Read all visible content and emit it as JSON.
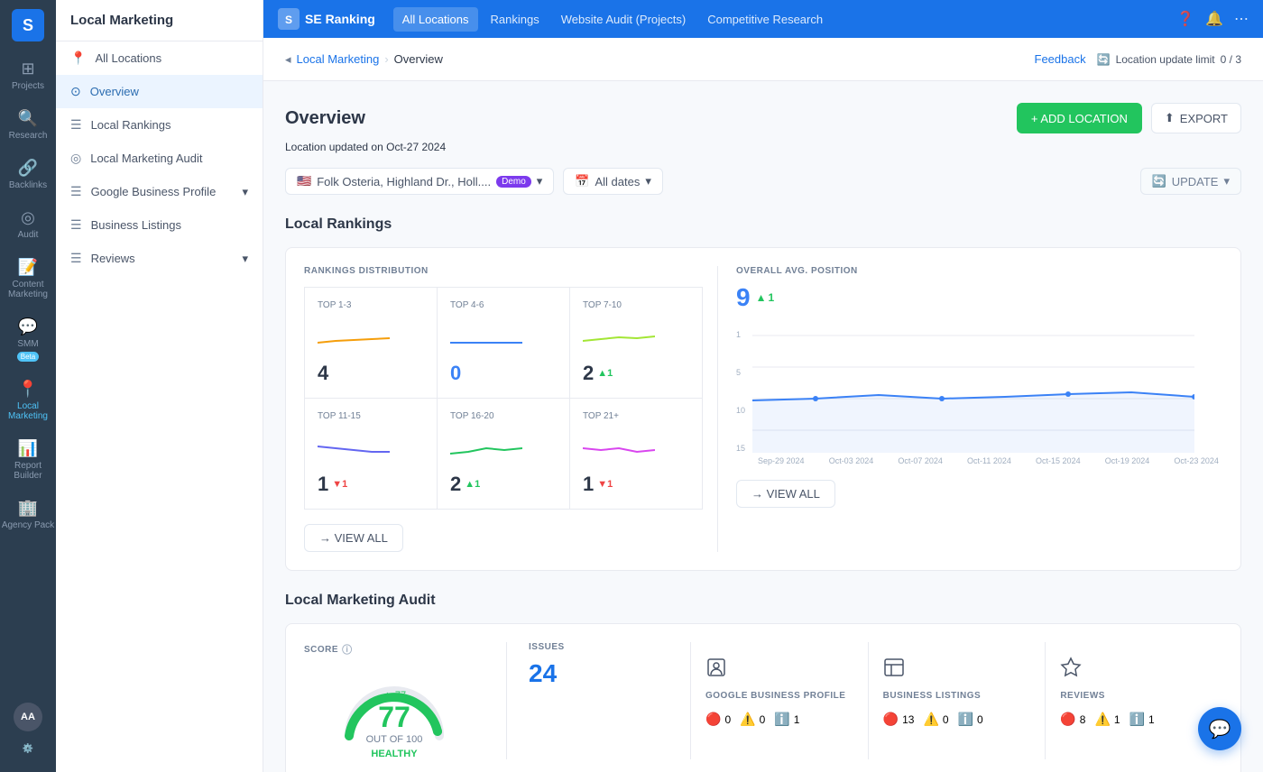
{
  "app": {
    "logo_text": "SE Ranking",
    "logo_icon": "📊"
  },
  "top_nav": {
    "items": [
      {
        "id": "all-locations",
        "label": "All Locations",
        "active": true
      },
      {
        "id": "rankings",
        "label": "Rankings",
        "active": false
      },
      {
        "id": "website-audit",
        "label": "Website Audit (Projects)",
        "active": false
      },
      {
        "id": "competitive-research",
        "label": "Competitive Research",
        "active": false
      }
    ]
  },
  "sidebar": {
    "header": "Local Marketing",
    "items": [
      {
        "id": "all-locations",
        "label": "All Locations",
        "icon": "📍",
        "active": false
      },
      {
        "id": "overview",
        "label": "Overview",
        "icon": "⊙",
        "active": true
      },
      {
        "id": "local-rankings",
        "label": "Local Rankings",
        "icon": "☰",
        "active": false
      },
      {
        "id": "local-marketing-audit",
        "label": "Local Marketing Audit",
        "icon": "◎",
        "active": false
      },
      {
        "id": "google-business-profile",
        "label": "Google Business Profile",
        "icon": "☰",
        "active": false,
        "has_submenu": true
      },
      {
        "id": "business-listings",
        "label": "Business Listings",
        "icon": "☰",
        "active": false
      },
      {
        "id": "reviews",
        "label": "Reviews",
        "icon": "☰",
        "active": false,
        "has_submenu": true
      }
    ]
  },
  "left_nav": {
    "items": [
      {
        "id": "projects",
        "label": "Projects",
        "icon": "⊞"
      },
      {
        "id": "research",
        "label": "Research",
        "icon": "🔍"
      },
      {
        "id": "backlinks",
        "label": "Backlinks",
        "icon": "🔗"
      },
      {
        "id": "audit",
        "label": "Audit",
        "icon": "◎"
      },
      {
        "id": "content-marketing",
        "label": "Content Marketing",
        "icon": "📝"
      },
      {
        "id": "smm",
        "label": "SMM",
        "icon": "💬",
        "badge": "Beta"
      },
      {
        "id": "local-marketing",
        "label": "Local Marketing",
        "icon": "📍",
        "active": true
      },
      {
        "id": "report-builder",
        "label": "Report Builder",
        "icon": "📊"
      },
      {
        "id": "agency-pack",
        "label": "Agency Pack",
        "icon": "🏢"
      }
    ],
    "avatar_initials": "AA"
  },
  "breadcrumb": {
    "parent": "Local Marketing",
    "current": "Overview"
  },
  "top_right": {
    "feedback_label": "Feedback",
    "location_update_icon": "🔄",
    "location_update_text": "Location update limit",
    "location_update_value": "0 / 3"
  },
  "page": {
    "title": "Overview",
    "location_updated_label": "Location updated on",
    "location_updated_date": "Oct-27 2024",
    "add_location_label": "+ ADD LOCATION",
    "export_label": "EXPORT"
  },
  "filters": {
    "location_name": "Folk Osteria, Highland Dr., Holl....",
    "demo_badge": "Demo",
    "dates_label": "All dates",
    "update_label": "UPDATE"
  },
  "local_rankings": {
    "section_title": "Local Rankings",
    "dist_label": "RANKINGS DISTRIBUTION",
    "avg_label": "OVERALL AVG. POSITION",
    "avg_value": "9",
    "avg_change": "▲1",
    "avg_change_sign": "+",
    "cells": [
      {
        "label": "TOP 1-3",
        "value": "4",
        "change": "",
        "color": "orange"
      },
      {
        "label": "TOP 4-6",
        "value": "0",
        "change": "",
        "color": "blue"
      },
      {
        "label": "TOP 7-10",
        "value": "2",
        "change": "▲1",
        "color": "yellow-green"
      },
      {
        "label": "TOP 11-15",
        "value": "1",
        "change": "▼1",
        "color": "blue-dark"
      },
      {
        "label": "TOP 16-20",
        "value": "2",
        "change": "▲1",
        "color": "green"
      },
      {
        "label": "TOP 21+",
        "value": "1",
        "change": "▼1",
        "color": "purple"
      }
    ],
    "chart_x_labels": [
      "Sep-29 2024",
      "Oct-03 2024",
      "Oct-07 2024",
      "Oct-11 2024",
      "Oct-15 2024",
      "Oct-19 2024",
      "Oct-23 2024"
    ],
    "chart_y_labels": [
      "1",
      "5",
      "10",
      "15"
    ],
    "view_all_label": "→ VIEW ALL"
  },
  "local_marketing_audit": {
    "section_title": "Local Marketing Audit",
    "score_label": "SCORE",
    "score_value": "77",
    "score_change": "▲ 77",
    "score_out_of": "OUT OF 100",
    "score_status": "HEALTHY",
    "issues_label": "ISSUES",
    "issues_count": "24",
    "details": [
      {
        "id": "google-business-profile",
        "icon": "👤",
        "label": "GOOGLE BUSINESS PROFILE",
        "errors": "0",
        "warnings": "0",
        "info": "1"
      },
      {
        "id": "business-listings",
        "icon": "🏪",
        "label": "BUSINESS LISTINGS",
        "errors": "13",
        "warnings": "0",
        "info": "0"
      },
      {
        "id": "reviews",
        "icon": "⭐",
        "label": "REVIEWS",
        "errors": "8",
        "warnings": "1",
        "info": "1"
      }
    ]
  }
}
